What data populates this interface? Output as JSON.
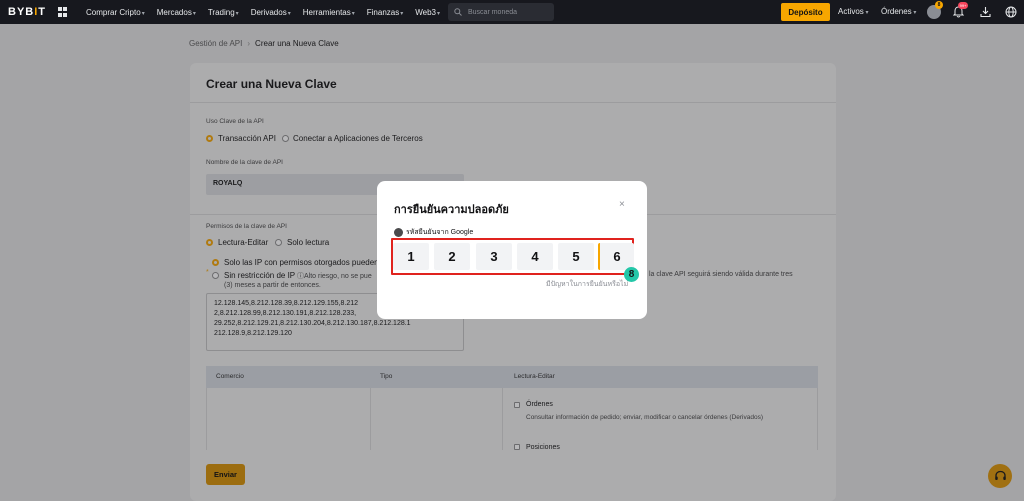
{
  "topnav": {
    "logo": "BYBIT",
    "items": [
      {
        "label": "Comprar Cripto"
      },
      {
        "label": "Mercados"
      },
      {
        "label": "Trading"
      },
      {
        "label": "Derivados"
      },
      {
        "label": "Herramientas"
      },
      {
        "label": "Finanzas"
      },
      {
        "label": "Web3"
      }
    ],
    "search_placeholder": "Buscar moneda",
    "deposit_label": "Depósito",
    "activos_label": "Activos",
    "ordenes_label": "Órdenes",
    "avatar_badge": "8",
    "bell_badge": "99+"
  },
  "breadcrumb": {
    "parent": "Gestión de API",
    "current": "Crear una Nueva Clave"
  },
  "form": {
    "title": "Crear una Nueva Clave",
    "usage_label": "Uso Clave de la API",
    "usage_option_1": "Transacción API",
    "usage_option_2": "Conectar a Aplicaciones de Terceros",
    "name_label": "Nombre de la clave de API",
    "name_value": "ROYALQ",
    "perm_label": "Permisos de la clave de API",
    "perm_option_1": "Lectura-Editar",
    "perm_option_2": "Solo lectura",
    "ip_option_1": "Solo las IP con permisos otorgados pueden a",
    "ip_option_2": "Sin restricción de IP",
    "ip_warning": "Alto riesgo, no se pue",
    "ip_warning_right": "la clave API seguirá siendo válida durante tres",
    "ip_warning_line2": "(3) meses a partir de entonces.",
    "ip_lines": [
      "12.128.145,8.212.128.39,8.212.129.155,8.212",
      "2,8.212.128.99,8.212.130.191,8.212.128.233,",
      "29.252,8.212.129.21,8.212.130.204,8.212.130.187,8.212.128.1",
      "212.128.9,8.212.129.120"
    ],
    "table_headers": [
      "Comercio",
      "Tipo",
      "Lectura-Editar"
    ],
    "row_1_title": "Órdenes",
    "row_1_desc": "Consultar información de pedido; enviar, modificar o cancelar órdenes (Derivados)",
    "row_2_title": "Posiciones",
    "submit_label": "Enviar"
  },
  "modal": {
    "title": "การยืนยันความปลอดภัย",
    "google_label": "รหัสยืนยันจาก Google",
    "digits": [
      "1",
      "2",
      "3",
      "4",
      "5",
      "6"
    ],
    "step_badge": "8",
    "problem_link": "มีปัญหาในการยืนยันหรือไม่"
  },
  "colors": {
    "accent": "#f7a600",
    "highlight_border": "#e0231e",
    "step_badge": "#24c7a8"
  }
}
